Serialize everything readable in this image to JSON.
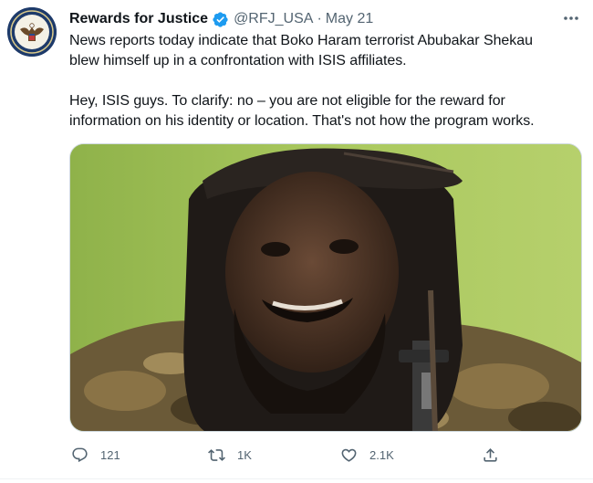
{
  "tweet": {
    "display_name": "Rewards for Justice",
    "handle": "@RFJ_USA",
    "separator": "·",
    "date": "May 21",
    "paragraph_1": "News reports today indicate that Boko Haram terrorist Abubakar Shekau\nblew himself up in a confrontation with ISIS affiliates.",
    "paragraph_2": "Hey, ISIS guys. To clarify:  no – you are not eligible for the reward for\ninformation on his identity or location. That's not how the program works."
  },
  "actions": {
    "reply_count": "121",
    "retweet_count": "1K",
    "like_count": "2.1K"
  },
  "icons": {
    "verified": "verified-badge-icon",
    "more": "more-dots-icon",
    "reply": "reply-icon",
    "retweet": "retweet-icon",
    "like": "heart-icon",
    "share": "share-icon"
  },
  "colors": {
    "verified_blue": "#1d9bf0",
    "secondary_text": "#536471",
    "primary_text": "#0f1419"
  }
}
